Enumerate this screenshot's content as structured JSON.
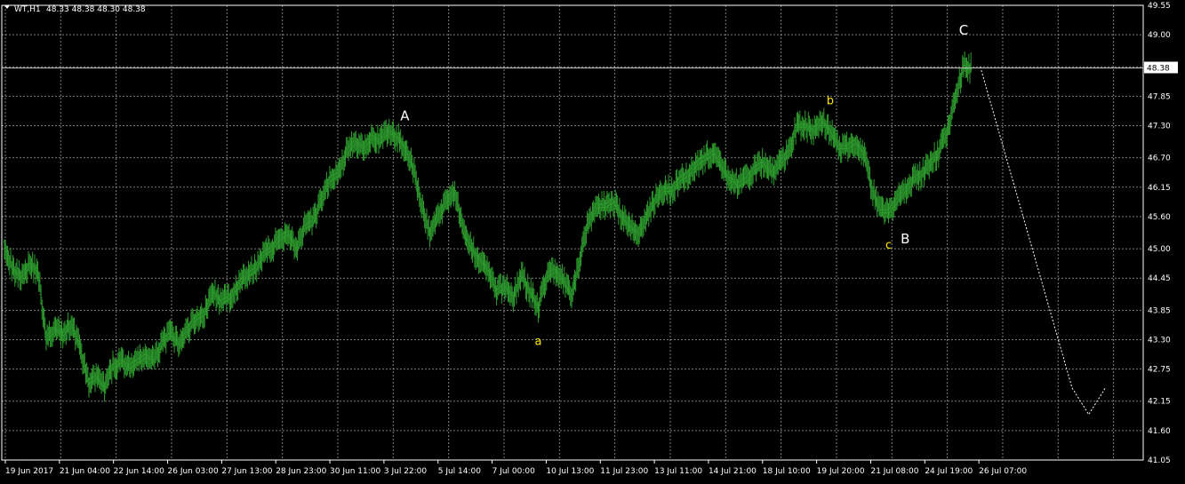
{
  "header": {
    "symbol": "WT,H1",
    "quotes": "48.33 48.38 48.30 48.38"
  },
  "colors": {
    "background": "#000000",
    "grid": "#b4b4b4",
    "bars": "#2e9e2e",
    "wave_primary": "#ffffff",
    "wave_secondary": "#ffe600",
    "projection": "#ffffff",
    "price_line": "#bfbfbf"
  },
  "chart_data": {
    "type": "ohlc",
    "timeframe": "H1",
    "ylim": [
      41.05,
      49.55
    ],
    "y_ticks": [
      "49.55",
      "49.00",
      "48.40",
      "47.85",
      "47.30",
      "46.70",
      "46.15",
      "45.60",
      "45.00",
      "44.45",
      "43.85",
      "43.30",
      "42.75",
      "42.15",
      "41.60",
      "41.05"
    ],
    "x_ticks": [
      "19 Jun 2017",
      "21 Jun 04:00",
      "22 Jun 14:00",
      "26 Jun 03:00",
      "27 Jun 13:00",
      "28 Jun 23:00",
      "30 Jun 11:00",
      "3 Jul 22:00",
      "5 Jul 14:00",
      "7 Jul 00:00",
      "10 Jul 13:00",
      "11 Jul 23:00",
      "13 Jul 11:00",
      "14 Jul 21:00",
      "18 Jul 10:00",
      "19 Jul 20:00",
      "21 Jul 08:00",
      "24 Jul 19:00",
      "26 Jul 07:00"
    ],
    "current_price": "48.38",
    "price_path": [
      [
        0,
        45.1
      ],
      [
        1,
        44.6
      ],
      [
        2,
        44.5
      ],
      [
        3,
        44.7
      ],
      [
        4,
        44.6
      ],
      [
        5,
        43.3
      ],
      [
        6,
        43.5
      ],
      [
        7,
        43.4
      ],
      [
        8,
        43.6
      ],
      [
        9,
        43.2
      ],
      [
        10,
        42.5
      ],
      [
        11,
        42.6
      ],
      [
        12,
        42.4
      ],
      [
        13,
        42.8
      ],
      [
        14,
        42.9
      ],
      [
        15,
        42.8
      ],
      [
        16,
        42.9
      ],
      [
        17,
        43.0
      ],
      [
        18,
        42.9
      ],
      [
        19,
        43.3
      ],
      [
        20,
        43.4
      ],
      [
        21,
        43.2
      ],
      [
        22,
        43.5
      ],
      [
        23,
        43.7
      ],
      [
        24,
        43.8
      ],
      [
        25,
        44.2
      ],
      [
        26,
        44.0
      ],
      [
        27,
        44.1
      ],
      [
        28,
        44.3
      ],
      [
        29,
        44.5
      ],
      [
        30,
        44.6
      ],
      [
        31,
        44.9
      ],
      [
        32,
        45.0
      ],
      [
        33,
        45.2
      ],
      [
        34,
        45.3
      ],
      [
        35,
        45.0
      ],
      [
        36,
        45.4
      ],
      [
        37,
        45.5
      ],
      [
        38,
        45.9
      ],
      [
        39,
        46.3
      ],
      [
        40,
        46.4
      ],
      [
        41,
        46.8
      ],
      [
        42,
        47.0
      ],
      [
        43,
        46.9
      ],
      [
        44,
        47.1
      ],
      [
        45,
        47.0
      ],
      [
        46,
        47.2
      ],
      [
        47,
        47.1
      ],
      [
        48,
        46.9
      ],
      [
        49,
        46.5
      ],
      [
        50,
        45.8
      ],
      [
        51,
        45.3
      ],
      [
        52,
        45.6
      ],
      [
        53,
        45.9
      ],
      [
        54,
        46.1
      ],
      [
        55,
        45.3
      ],
      [
        56,
        45.0
      ],
      [
        57,
        44.8
      ],
      [
        58,
        44.6
      ],
      [
        59,
        44.2
      ],
      [
        60,
        44.3
      ],
      [
        61,
        44.1
      ],
      [
        62,
        44.5
      ],
      [
        63,
        44.2
      ],
      [
        64,
        43.9
      ],
      [
        65,
        44.5
      ],
      [
        66,
        44.6
      ],
      [
        67,
        44.4
      ],
      [
        68,
        44.1
      ],
      [
        69,
        44.8
      ],
      [
        70,
        45.5
      ],
      [
        71,
        45.8
      ],
      [
        72,
        45.8
      ],
      [
        73,
        45.9
      ],
      [
        74,
        45.6
      ],
      [
        75,
        45.4
      ],
      [
        76,
        45.3
      ],
      [
        77,
        45.6
      ],
      [
        78,
        45.9
      ],
      [
        79,
        46.1
      ],
      [
        80,
        46.1
      ],
      [
        81,
        46.3
      ],
      [
        82,
        46.4
      ],
      [
        83,
        46.6
      ],
      [
        84,
        46.7
      ],
      [
        85,
        46.8
      ],
      [
        86,
        46.5
      ],
      [
        87,
        46.3
      ],
      [
        88,
        46.2
      ],
      [
        89,
        46.3
      ],
      [
        90,
        46.5
      ],
      [
        91,
        46.6
      ],
      [
        92,
        46.4
      ],
      [
        93,
        46.6
      ],
      [
        94,
        46.8
      ],
      [
        95,
        47.3
      ],
      [
        96,
        47.3
      ],
      [
        97,
        47.2
      ],
      [
        98,
        47.4
      ],
      [
        99,
        47.2
      ],
      [
        100,
        46.9
      ],
      [
        101,
        46.9
      ],
      [
        102,
        47.0
      ],
      [
        103,
        46.8
      ],
      [
        104,
        46.1
      ],
      [
        105,
        45.7
      ],
      [
        106,
        45.7
      ],
      [
        107,
        45.9
      ],
      [
        108,
        46.1
      ],
      [
        109,
        46.3
      ],
      [
        110,
        46.4
      ],
      [
        111,
        46.6
      ],
      [
        112,
        46.8
      ],
      [
        113,
        47.2
      ],
      [
        114,
        47.8
      ],
      [
        115,
        48.4
      ],
      [
        116,
        48.38
      ]
    ],
    "projection_path": [
      [
        117,
        48.4
      ],
      [
        128,
        42.4
      ],
      [
        130,
        41.9
      ],
      [
        132,
        42.4
      ]
    ],
    "wave_labels": [
      {
        "text": "A",
        "x": 48,
        "y": 47.4,
        "level": "primary"
      },
      {
        "text": "a",
        "x": 64,
        "y": 43.2,
        "level": "secondary"
      },
      {
        "text": "b",
        "x": 99,
        "y": 47.7,
        "level": "secondary"
      },
      {
        "text": "c",
        "x": 106,
        "y": 45.0,
        "level": "secondary"
      },
      {
        "text": "B",
        "x": 108,
        "y": 45.1,
        "level": "primary"
      },
      {
        "text": "C",
        "x": 115,
        "y": 49.0,
        "level": "primary"
      }
    ]
  }
}
